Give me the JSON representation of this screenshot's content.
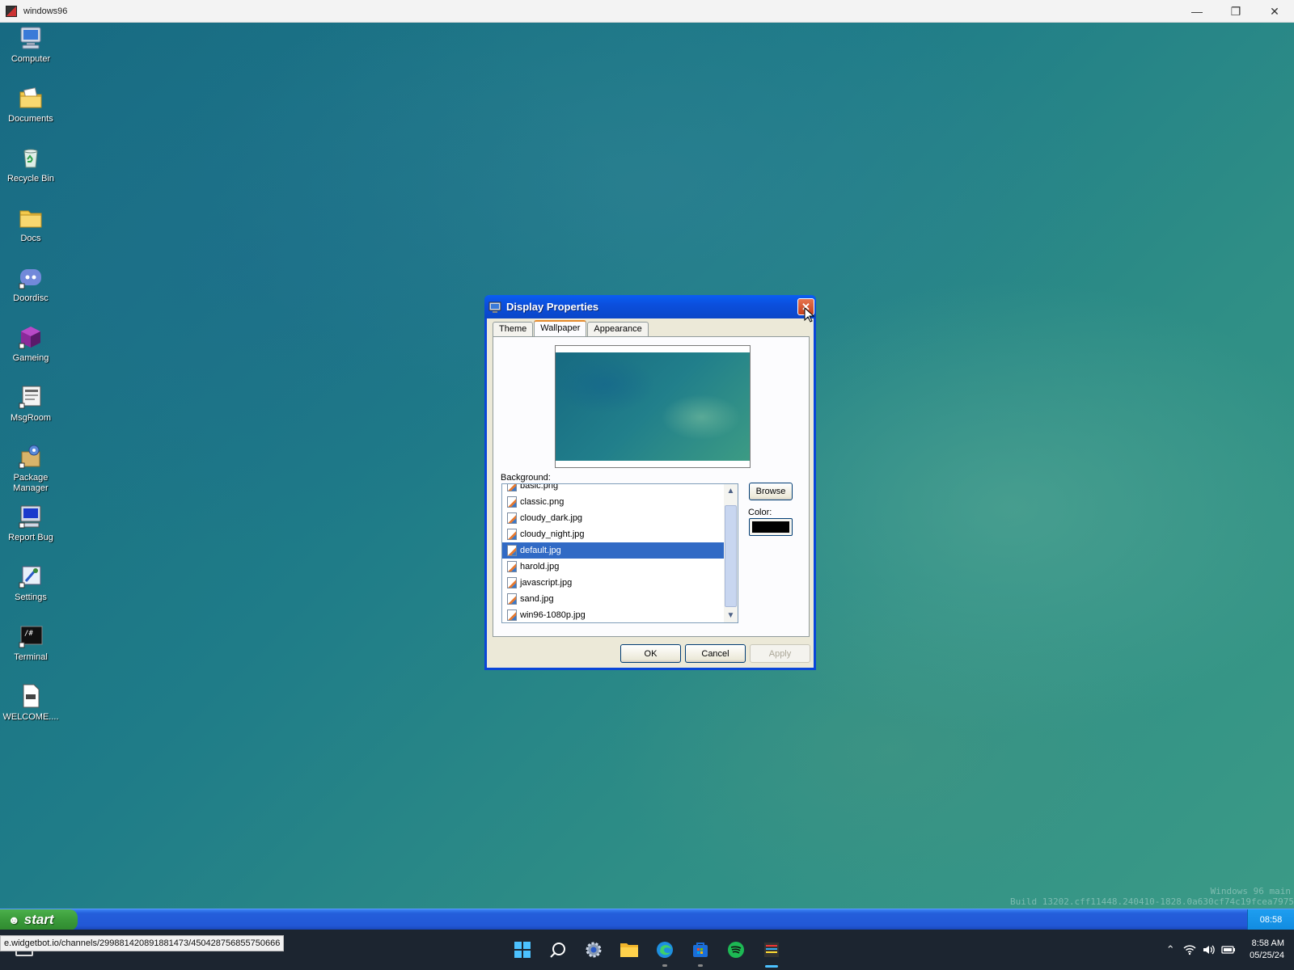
{
  "host_window": {
    "title": "windows96",
    "minimize": "—",
    "restore": "❐",
    "close": "✕"
  },
  "desktop": {
    "icons": [
      {
        "label": "Computer",
        "icon": "computer-icon"
      },
      {
        "label": "Documents",
        "icon": "documents-folder-icon"
      },
      {
        "label": "Recycle Bin",
        "icon": "recycle-bin-icon"
      },
      {
        "label": "Docs",
        "icon": "folder-icon"
      },
      {
        "label": "Doordisc",
        "icon": "doordisc-icon"
      },
      {
        "label": "Gameing",
        "icon": "game-cube-icon"
      },
      {
        "label": "MsgRoom",
        "icon": "msgroom-icon"
      },
      {
        "label": "Package Manager",
        "icon": "package-manager-icon"
      },
      {
        "label": "Report Bug",
        "icon": "report-bug-icon"
      },
      {
        "label": "Settings",
        "icon": "settings-icon"
      },
      {
        "label": "Terminal",
        "icon": "terminal-icon"
      },
      {
        "label": "WELCOME....",
        "icon": "welcome-doc-icon"
      }
    ],
    "watermark_line1": "Windows 96 main",
    "watermark_line2": "Build 13202.cff11448.240410-1828.0a630cf74c19fcea7975"
  },
  "dialog": {
    "title": "Display Properties",
    "close_label": "✕",
    "tabs": [
      {
        "label": "Theme",
        "active": false
      },
      {
        "label": "Wallpaper",
        "active": true
      },
      {
        "label": "Appearance",
        "active": false
      }
    ],
    "background_label": "Background:",
    "files": [
      {
        "name": "basic.png",
        "selected": false
      },
      {
        "name": "classic.png",
        "selected": false
      },
      {
        "name": "cloudy_dark.jpg",
        "selected": false
      },
      {
        "name": "cloudy_night.jpg",
        "selected": false
      },
      {
        "name": "default.jpg",
        "selected": true
      },
      {
        "name": "harold.jpg",
        "selected": false
      },
      {
        "name": "javascript.jpg",
        "selected": false
      },
      {
        "name": "sand.jpg",
        "selected": false
      },
      {
        "name": "win96-1080p.jpg",
        "selected": false
      }
    ],
    "browse_label": "Browse",
    "color_label": "Color:",
    "color_value": "#000000",
    "ok_label": "OK",
    "cancel_label": "Cancel",
    "apply_label": "Apply"
  },
  "taskbar96": {
    "start_label": "start",
    "clock": "08:58"
  },
  "host_taskbar": {
    "status_url": "e.widgetbot.io/channels/299881420891881473/450428756855750666",
    "apps": [
      "windows-start-icon",
      "search-icon",
      "settings-gear-icon",
      "file-explorer-icon",
      "edge-browser-icon",
      "store-icon",
      "spotify-icon",
      "windows96-app-icon"
    ],
    "time": "8:58 AM",
    "date": "05/25/24"
  },
  "colors": {
    "xp_title_blue": "#0a46d8",
    "selection_blue": "#316ac5",
    "start_green": "#3a9a3a",
    "taskbar_blue": "#245edb",
    "host_taskbar": "#1c2530"
  }
}
